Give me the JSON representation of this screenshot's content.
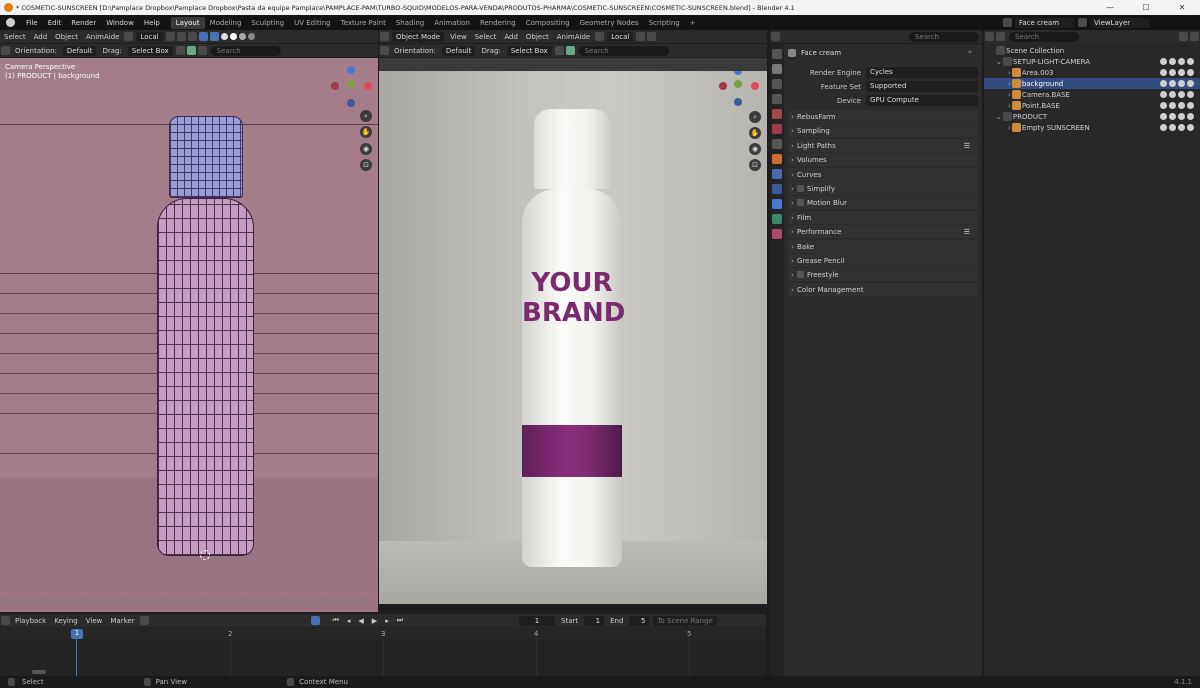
{
  "window": {
    "title": "* COSMETIC-SUNSCREEN [D:\\Pamplace Dropbox\\Pamplace Dropbox\\Pasta da equipe Pamplace\\PAMPLACE-PAM\\TURBO-SQUID\\MODELOS-PARA-VENDA\\PRODUTOS-PHARMA\\COSMETIC-SUNSCREEN\\COSMETIC-SUNSCREEN.blend] - Blender 4.1",
    "minimize": "—",
    "maximize": "☐",
    "close": "✕"
  },
  "menu": [
    "File",
    "Edit",
    "Render",
    "Window",
    "Help"
  ],
  "workspaces": [
    {
      "label": "Layout",
      "active": true
    },
    {
      "label": "Modeling"
    },
    {
      "label": "Sculpting"
    },
    {
      "label": "UV Editing"
    },
    {
      "label": "Texture Paint"
    },
    {
      "label": "Shading"
    },
    {
      "label": "Animation"
    },
    {
      "label": "Rendering"
    },
    {
      "label": "Compositing"
    },
    {
      "label": "Geometry Nodes"
    },
    {
      "label": "Scripting"
    },
    {
      "label": "+"
    }
  ],
  "scene": {
    "name": "Face cream",
    "view_layer": "ViewLayer"
  },
  "left_view": {
    "menus": [
      "Select",
      "Add",
      "Object",
      "AnimAide"
    ],
    "transform": "Local",
    "orientation_label": "Orientation:",
    "orientation": "Default",
    "drag_label": "Drag:",
    "drag": "Select Box",
    "search": "Search",
    "overlay_title": "Camera Perspective",
    "overlay_sub": "(1) PRODUCT | background"
  },
  "right_view": {
    "mode": "Object Mode",
    "menus": [
      "View",
      "Select",
      "Add",
      "Object",
      "AnimAide"
    ],
    "transform": "Local",
    "orientation_label": "Orientation:",
    "orientation": "Default",
    "drag_label": "Drag:",
    "drag": "Select Box",
    "search": "Search",
    "brand_line1": "YOUR",
    "brand_line2": "BRAND"
  },
  "properties": {
    "object": "Face cream",
    "fields": [
      {
        "label": "Render Engine",
        "value": "Cycles"
      },
      {
        "label": "Feature Set",
        "value": "Supported"
      },
      {
        "label": "Device",
        "value": "GPU Compute"
      }
    ],
    "panels": [
      {
        "label": "RebusFarm"
      },
      {
        "label": "Sampling"
      },
      {
        "label": "Light Paths",
        "list": true
      },
      {
        "label": "Volumes"
      },
      {
        "label": "Curves"
      },
      {
        "label": "Simplify",
        "check": true
      },
      {
        "label": "Motion Blur",
        "check": true
      },
      {
        "label": "Film"
      },
      {
        "label": "Performance",
        "list": true
      },
      {
        "label": "Bake"
      },
      {
        "label": "Grease Pencil"
      },
      {
        "label": "Freestyle",
        "check": true
      },
      {
        "label": "Color Management"
      }
    ],
    "search": "Search"
  },
  "outliner": {
    "search": "Search",
    "rows": [
      {
        "label": "Scene Collection",
        "depth": 0
      },
      {
        "label": "SETUP-LIGHT-CAMERA",
        "depth": 1
      },
      {
        "label": "Area.003",
        "depth": 2
      },
      {
        "label": "background",
        "depth": 2,
        "selected": true
      },
      {
        "label": "Camera.BASE",
        "depth": 2
      },
      {
        "label": "Point.BASE",
        "depth": 2
      },
      {
        "label": "PRODUCT",
        "depth": 1
      },
      {
        "label": "Empty SUNSCREEN",
        "depth": 2
      }
    ]
  },
  "timeline": {
    "menus": [
      "Playback",
      "Keying",
      "View",
      "Marker"
    ],
    "current_frame": "1",
    "start_label": "Start",
    "start": "1",
    "end_label": "End",
    "end": "5",
    "range_label": "To Scene Range",
    "frames": [
      "1",
      "2",
      "3",
      "4",
      "5"
    ]
  },
  "status": {
    "left": "Select",
    "mid": "Pan View",
    "ctx": "Context Menu",
    "version": "4.1.1"
  },
  "colors": {
    "accent": "#4772b3",
    "brand": "#7a2a6e",
    "selected": "#334d80"
  }
}
